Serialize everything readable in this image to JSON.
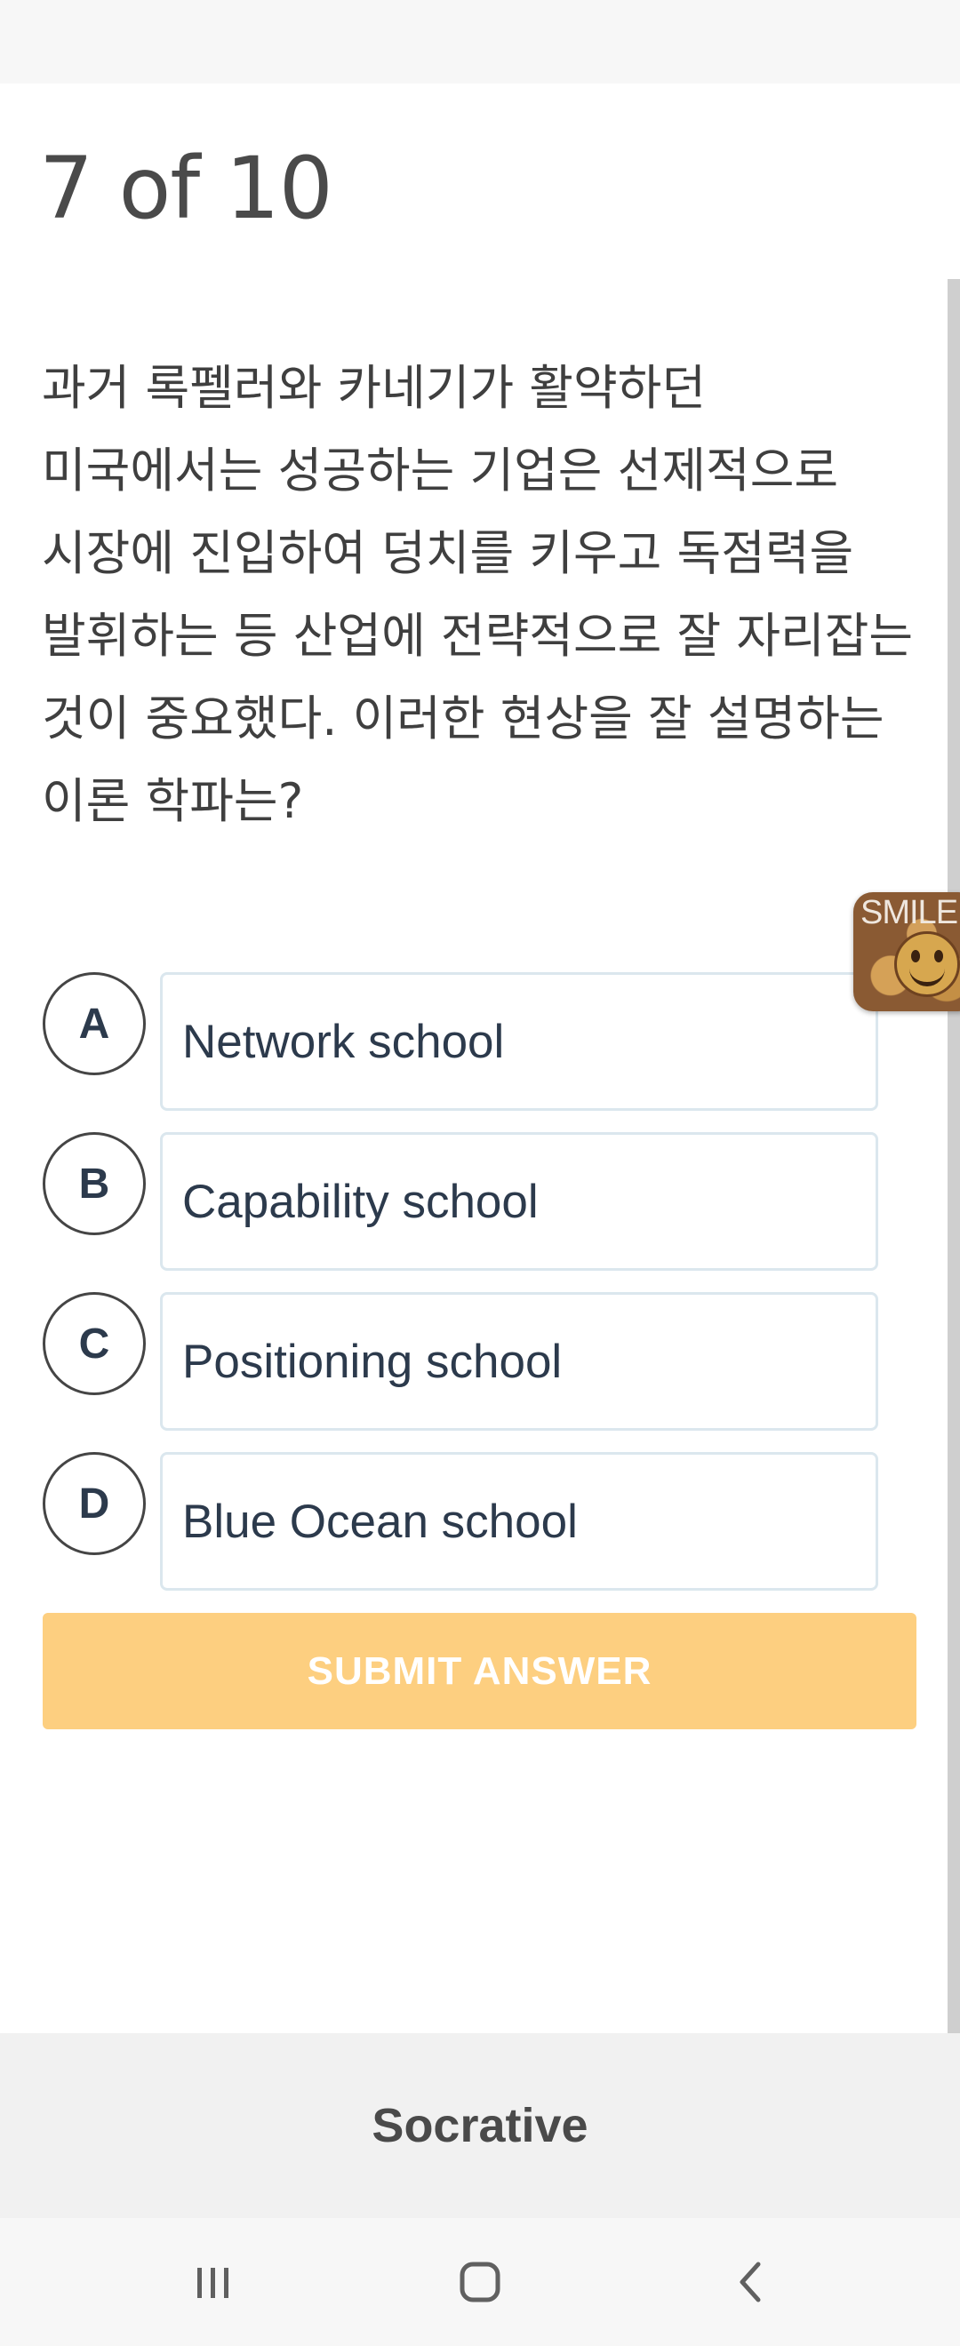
{
  "quiz": {
    "progress": "7 of 10",
    "question": "과거 록펠러와 카네기가 활약하던 미국에서는 성공하는 기업은 선제적으로 시장에 진입하여 덩치를 키우고 독점력을 발휘하는 등 산업에 전략적으로 잘 자리잡는 것이 중요했다. 이러한 현상을 잘 설명하는 이론 학파는?",
    "choices": [
      {
        "letter": "A",
        "text": "Network school"
      },
      {
        "letter": "B",
        "text": "Capability school"
      },
      {
        "letter": "C",
        "text": "Positioning school"
      },
      {
        "letter": "D",
        "text": "Blue Ocean school"
      }
    ],
    "submit_label": "SUBMIT ANSWER"
  },
  "overlay": {
    "badge_text": "SMILE"
  },
  "footer": {
    "brand": "Socrative"
  },
  "nav": {
    "recent_icon": "recent-apps-icon",
    "home_icon": "home-icon",
    "back_icon": "back-icon"
  },
  "colors": {
    "submit_button": "#fdcf80",
    "choice_border": "#dbe7ee",
    "choice_text": "#2c3a4c",
    "footer_background": "#f1f1f1"
  }
}
